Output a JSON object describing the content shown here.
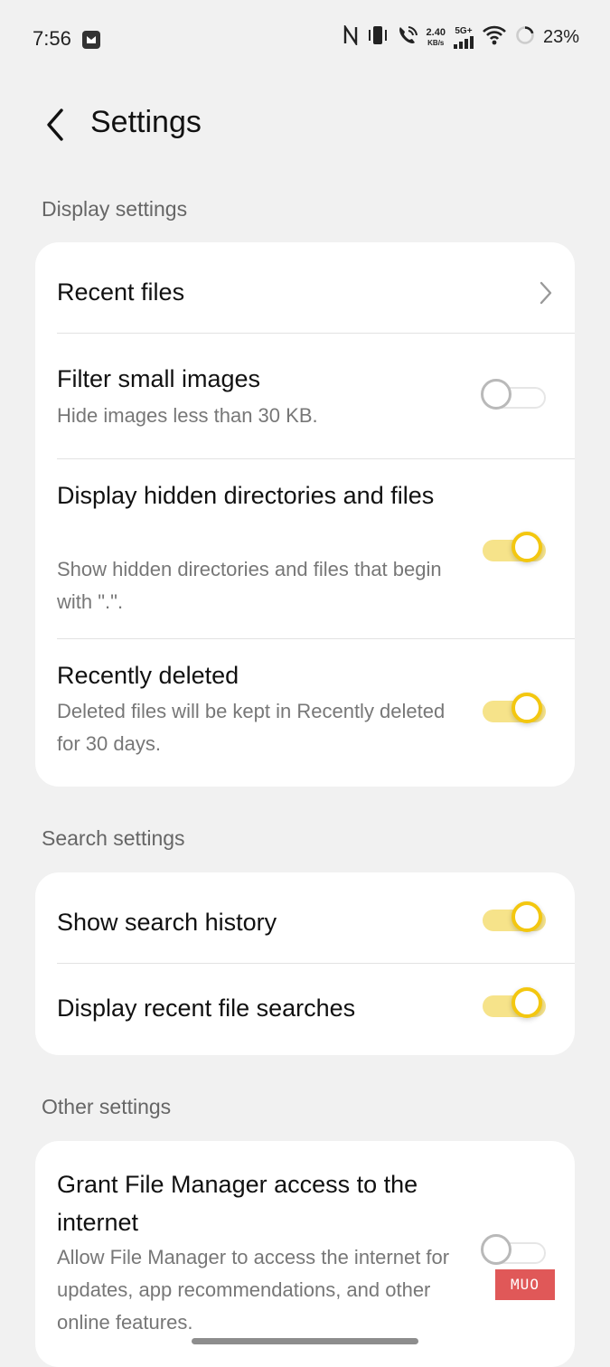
{
  "status_bar": {
    "time": "7:56",
    "net_speed_value": "2.40",
    "net_speed_unit": "KB/s",
    "network_type": "5G+",
    "battery_percent": "23%",
    "icons": [
      "nfc-icon",
      "vibrate-icon",
      "wifi-calling-icon",
      "signal-icon",
      "wifi-icon",
      "battery-icon"
    ]
  },
  "header": {
    "title": "Settings"
  },
  "sections": {
    "display": {
      "title": "Display settings",
      "items": [
        {
          "title": "Recent files",
          "control": "chevron"
        },
        {
          "title": "Filter small images",
          "subtitle": "Hide images less than 30 KB.",
          "toggle": false
        },
        {
          "title": "Display hidden directories and files",
          "subtitle": "Show hidden directories and files that begin with \".\".",
          "toggle": true
        },
        {
          "title": "Recently deleted",
          "subtitle": "Deleted files will be kept in Recently deleted for 30 days.",
          "toggle": true
        }
      ]
    },
    "search": {
      "title": "Search settings",
      "items": [
        {
          "title": "Show search history",
          "toggle": true
        },
        {
          "title": "Display recent file searches",
          "toggle": true
        }
      ]
    },
    "other": {
      "title": "Other settings",
      "items": [
        {
          "title": "Grant File Manager access to the internet",
          "subtitle": "Allow File Manager to access the internet for updates, app recommendations, and other online features.",
          "toggle": false
        }
      ]
    }
  },
  "watermark": "MUO",
  "colors": {
    "accent": "#f3c710",
    "accent_track": "#f6e38a",
    "background": "#f1f1f1",
    "card": "#ffffff"
  }
}
